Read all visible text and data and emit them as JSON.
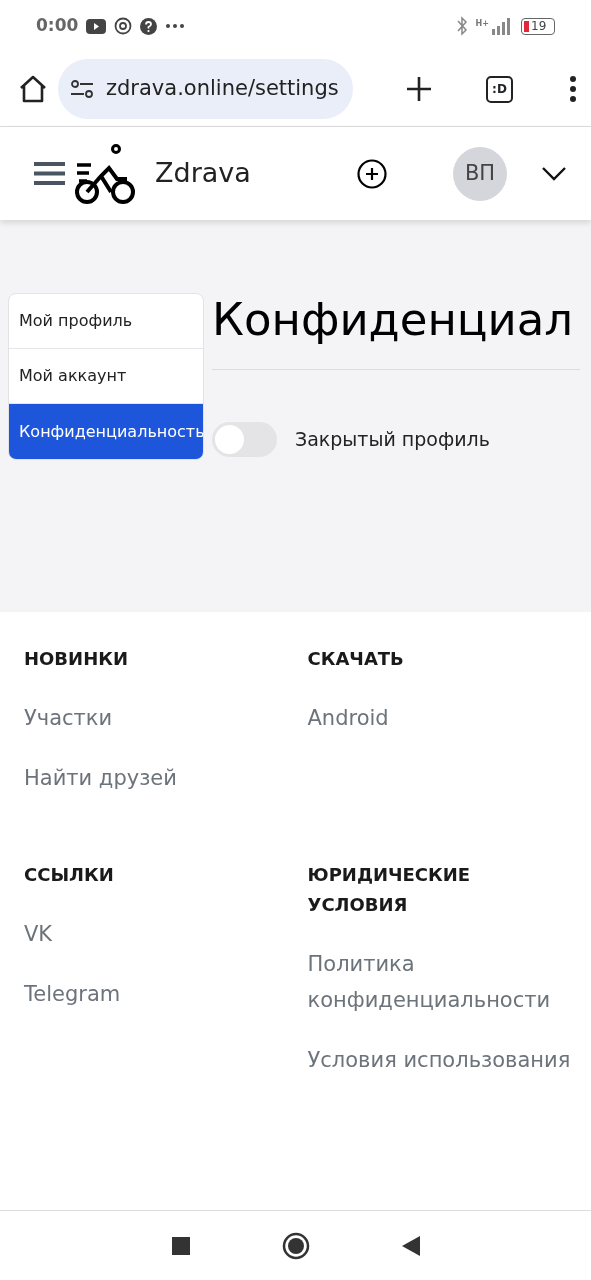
{
  "status_bar": {
    "time": "0:00",
    "network": "H+",
    "battery": "19"
  },
  "browser": {
    "url": "zdrava.online/settings",
    "tab_label": ":D"
  },
  "navbar": {
    "brand": "Zdrava",
    "avatar": "ВП"
  },
  "settings_menu": [
    {
      "label": "Мой профиль",
      "selected": false
    },
    {
      "label": "Мой аккаунт",
      "selected": false
    },
    {
      "label": "Конфиденциальность",
      "selected": true
    }
  ],
  "page": {
    "title": "Конфиденциал",
    "toggles": [
      {
        "label": "Закрытый профиль",
        "on": false
      }
    ]
  },
  "footer": {
    "columns": [
      {
        "heading": "НОВИНКИ",
        "links": [
          "Участки",
          "Найти друзей"
        ]
      },
      {
        "heading": "СКАЧАТЬ",
        "links": [
          "Android"
        ]
      },
      {
        "heading": "ССЫЛКИ",
        "links": [
          "VK",
          "Telegram"
        ]
      },
      {
        "heading": "ЮРИДИЧЕСКИЕ УСЛОВИЯ",
        "links": [
          "Политика конфиденциальности",
          "Условия использования"
        ]
      }
    ]
  }
}
